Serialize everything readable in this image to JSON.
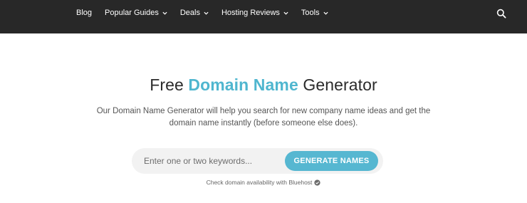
{
  "nav": {
    "items": [
      {
        "label": "Blog",
        "has_dropdown": false
      },
      {
        "label": "Popular Guides",
        "has_dropdown": true
      },
      {
        "label": "Deals",
        "has_dropdown": true
      },
      {
        "label": "Hosting Reviews",
        "has_dropdown": true
      },
      {
        "label": "Tools",
        "has_dropdown": true
      }
    ],
    "search_icon": "search-icon"
  },
  "hero": {
    "title_prefix": "Free ",
    "title_accent": "Domain Name",
    "title_suffix": " Generator",
    "description": "Our Domain Name Generator will help you search for new company name ideas and get the domain name instantly (before someone else does)."
  },
  "form": {
    "placeholder": "Enter one or two keywords...",
    "value": "",
    "button_label": "GENERATE NAMES"
  },
  "availability": {
    "text": "Check domain availability with Bluehost",
    "icon": "check-circle-icon"
  },
  "colors": {
    "nav_bg": "#282828",
    "accent": "#4fb6cf",
    "button_bg": "#56b7d1",
    "input_bg": "#f2f2f2"
  }
}
